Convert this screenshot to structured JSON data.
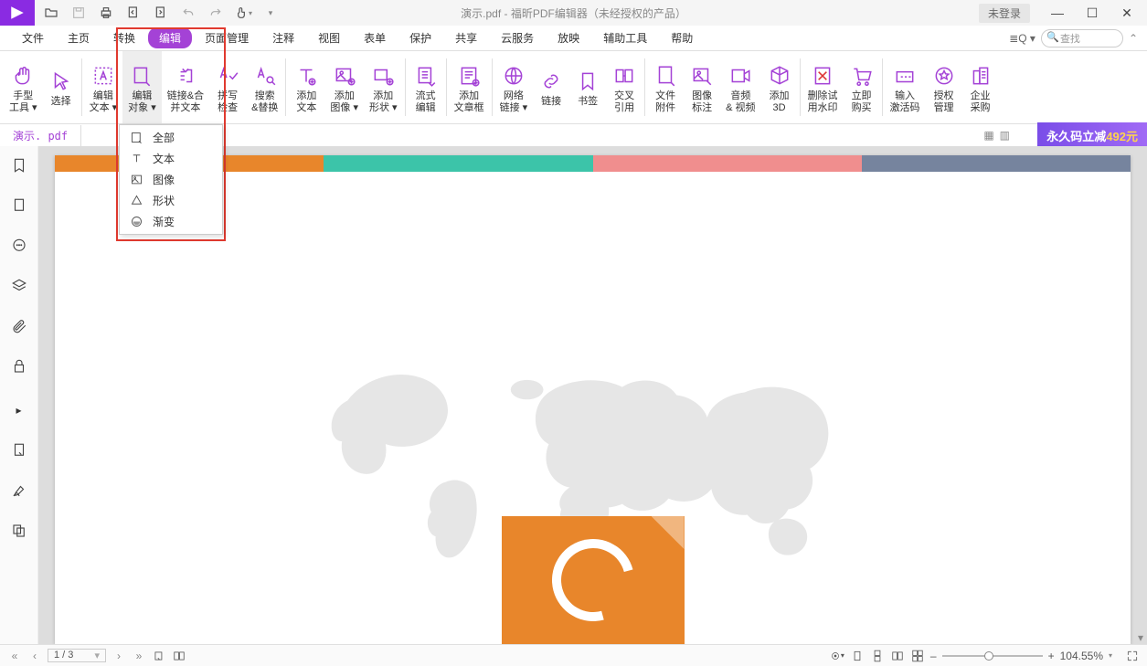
{
  "titlebar": {
    "title": "演示.pdf - 福昕PDF编辑器（未经授权的产品）",
    "login": "未登录"
  },
  "menubar": {
    "items": [
      "文件",
      "主页",
      "转换",
      "编辑",
      "页面管理",
      "注释",
      "视图",
      "表单",
      "保护",
      "共享",
      "云服务",
      "放映",
      "辅助工具",
      "帮助"
    ],
    "active_index": 3,
    "search_placeholder": "查找"
  },
  "ribbon": {
    "buttons": [
      {
        "label": "手型\n工具 ▾",
        "name": "hand-tool"
      },
      {
        "label": "选择",
        "name": "select-tool"
      },
      {
        "sep": true
      },
      {
        "label": "编辑\n文本 ▾",
        "name": "edit-text"
      },
      {
        "label": "编辑\n对象 ▾",
        "name": "edit-object",
        "sel": true
      },
      {
        "label": "链接&合\n并文本",
        "name": "link-merge-text"
      },
      {
        "label": "拼写\n检查",
        "name": "spell-check"
      },
      {
        "label": "搜索\n&替换",
        "name": "search-replace"
      },
      {
        "sep": true
      },
      {
        "label": "添加\n文本",
        "name": "add-text"
      },
      {
        "label": "添加\n图像 ▾",
        "name": "add-image"
      },
      {
        "label": "添加\n形状 ▾",
        "name": "add-shape"
      },
      {
        "sep": true
      },
      {
        "label": "流式\n编辑",
        "name": "reflow-edit"
      },
      {
        "sep": true
      },
      {
        "label": "添加\n文章框",
        "name": "add-article-box"
      },
      {
        "sep": true
      },
      {
        "label": "网络\n链接 ▾",
        "name": "web-link"
      },
      {
        "label": "链接",
        "name": "link"
      },
      {
        "label": "书签",
        "name": "bookmark"
      },
      {
        "label": "交叉\n引用",
        "name": "cross-ref"
      },
      {
        "sep": true
      },
      {
        "label": "文件\n附件",
        "name": "file-attach"
      },
      {
        "label": "图像\n标注",
        "name": "image-annot"
      },
      {
        "label": "音频\n& 视频",
        "name": "audio-video"
      },
      {
        "label": "添加\n3D",
        "name": "add-3d"
      },
      {
        "sep": true
      },
      {
        "label": "删除试\n用水印",
        "name": "remove-watermark"
      },
      {
        "label": "立即\n购买",
        "name": "buy-now"
      },
      {
        "sep": true
      },
      {
        "label": "输入\n激活码",
        "name": "activate"
      },
      {
        "label": "授权\n管理",
        "name": "license-mgmt"
      },
      {
        "label": "企业\n采购",
        "name": "enterprise-buy"
      }
    ]
  },
  "doctab": {
    "name": "演示. pdf"
  },
  "promo": {
    "text_a": "永久码立减",
    "amount": "492元"
  },
  "dropdown": {
    "items": [
      {
        "label": "全部",
        "name": "edit-all"
      },
      {
        "label": "文本",
        "name": "edit-text-item"
      },
      {
        "label": "图像",
        "name": "edit-image-item"
      },
      {
        "label": "形状",
        "name": "edit-shape-item"
      },
      {
        "label": "渐变",
        "name": "edit-gradient-item"
      }
    ]
  },
  "page": {
    "stripe_colors": [
      "#e8862b",
      "#3cc4a9",
      "#f08e8e",
      "#76849e"
    ]
  },
  "statusbar": {
    "page_current": "1",
    "page_total": "3",
    "zoom": "104.55%"
  }
}
